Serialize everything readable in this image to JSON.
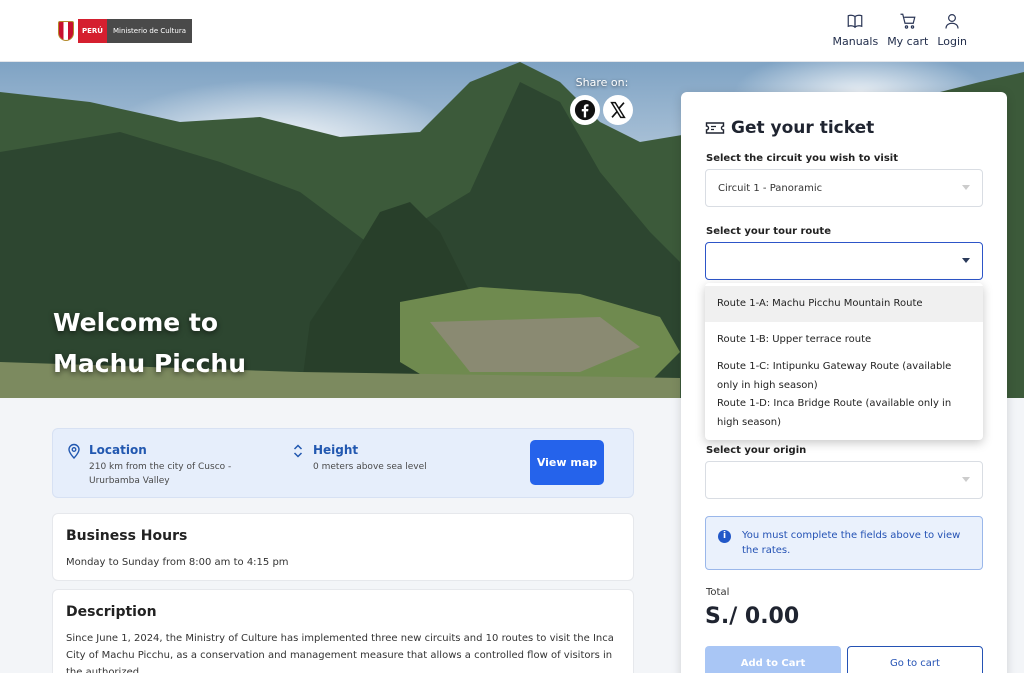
{
  "header": {
    "logo_country": "PERÚ",
    "logo_ministry": "Ministerio de Cultura",
    "nav": [
      {
        "label": "Manuals",
        "icon": "book-icon"
      },
      {
        "label": "My cart",
        "icon": "cart-icon"
      },
      {
        "label": "Login",
        "icon": "user-icon"
      }
    ]
  },
  "hero": {
    "title_line1": "Welcome to",
    "title_line2": "Machu Picchu",
    "share_label": "Share on:",
    "share_icons": [
      "facebook-icon",
      "x-icon"
    ]
  },
  "info": {
    "location_title": "Location",
    "location_text": "210 km from the city of Cusco - Ururbamba Valley",
    "height_title": "Height",
    "height_text": "0 meters above sea level",
    "view_map_label": "View map"
  },
  "business_hours": {
    "title": "Business Hours",
    "text": "Monday to Sunday from 8:00 am to 4:15 pm"
  },
  "description": {
    "title": "Description",
    "text": "Since June 1, 2024, the Ministry of Culture has implemented three new circuits and 10 routes to visit the Inca City of Machu Picchu, as a conservation and management measure that allows a controlled flow of visitors in the authorized"
  },
  "ticket": {
    "title": "Get your ticket",
    "circuit_label": "Select the circuit you wish to visit",
    "circuit_value": "Circuit 1 - Panoramic",
    "route_label": "Select your tour route",
    "route_value": "",
    "route_options": [
      "Route 1-A: Machu Picchu Mountain Route",
      "Route 1-B: Upper terrace route",
      "Route 1-C: Intipunku Gateway Route (available only in high season)",
      "Route 1-D: Inca Bridge Route (available only in high season)"
    ],
    "origin_label": "Select your origin",
    "origin_value": "",
    "alert_text": "You must complete the fields above to view the rates.",
    "total_label": "Total",
    "total_value": "S./ 0.00",
    "add_to_cart_label": "Add to Cart",
    "go_to_cart_label": "Go to cart"
  },
  "colors": {
    "primary": "#2563eb",
    "accent_blue": "#2452b4",
    "info_bg": "#e6eefb",
    "disabled_button": "#a9c6f5"
  }
}
